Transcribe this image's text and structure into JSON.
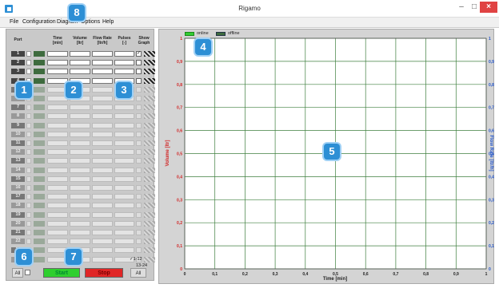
{
  "window": {
    "title": "Rigamo",
    "minimize_glyph": "–",
    "maximize_glyph": "□",
    "close_glyph": "×"
  },
  "menu": [
    "File",
    "Configuration",
    "Diagram",
    "Options",
    "Help"
  ],
  "table": {
    "headers": {
      "port": "Port",
      "time": "Time\n[min]",
      "volume": "Volume\n[ltr]",
      "flow": "Flow Rate\n[ltr/h]",
      "pulses": "Pulses\n[-]",
      "show": "Show\nGraph"
    },
    "active_ports": 4,
    "ports": [
      "1",
      "2",
      "3",
      "4",
      "5",
      "6",
      "7",
      "8",
      "9",
      "10",
      "11",
      "12",
      "13",
      "14",
      "15",
      "16",
      "17",
      "18",
      "19",
      "20",
      "21",
      "22",
      "23",
      "24"
    ],
    "row1_show_checked": true
  },
  "controls": {
    "all_left": "All",
    "start": "Start",
    "stop": "Stop",
    "range_1": "1-12",
    "range_2": "13-24",
    "all_right": "All"
  },
  "legend": {
    "online": "online",
    "offline": "offline"
  },
  "chart_data": {
    "type": "line",
    "xlabel": "Time [min]",
    "ylabel_left": "Volume [ltr]",
    "ylabel_right": "Flow Rate [ltr/h]",
    "xlim": [
      0,
      1
    ],
    "ylim_left": [
      0,
      1
    ],
    "ylim_right": [
      0,
      1
    ],
    "x_ticks": [
      "0",
      "0,1",
      "0,2",
      "0,3",
      "0,4",
      "0,5",
      "0,6",
      "0,7",
      "0,8",
      "0,9",
      "1"
    ],
    "y_ticks": [
      "0",
      "0,1",
      "0,2",
      "0,3",
      "0,4",
      "0,5",
      "0,6",
      "0,7",
      "0,8",
      "0,9",
      "1"
    ],
    "grid": true,
    "series": []
  },
  "annotations": [
    "1",
    "2",
    "3",
    "4",
    "5",
    "6",
    "7",
    "8"
  ],
  "colors": {
    "left_axis": "#d22222",
    "right_axis": "#2255cc",
    "grid": "#3f7f3f",
    "online_led": "#33cc33",
    "offline_led": "#3e6b3e",
    "start_button": "#2fcf2f",
    "stop_button": "#e02626",
    "badge": "#2d8fd5"
  }
}
